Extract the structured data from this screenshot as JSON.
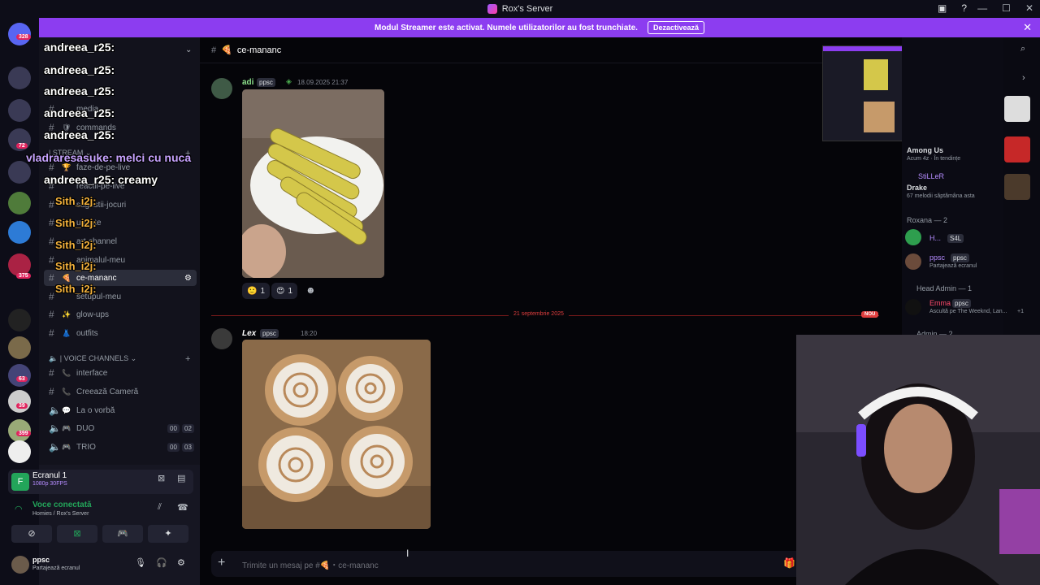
{
  "titlebar": {
    "title": "Rox's Server"
  },
  "banner": {
    "text": "Modul Streamer este activat. Numele utilizatorilor au fost trunchiate.",
    "button": "Dezactivează"
  },
  "guilds": {
    "badges": [
      "328",
      "72",
      "375",
      "63",
      "39",
      "399"
    ]
  },
  "channels": {
    "items": [
      {
        "name": "media",
        "emoji": ""
      },
      {
        "name": "commands",
        "emoji": "🛡"
      },
      {
        "name": "faze-de-pe-live",
        "emoji": "🏆"
      },
      {
        "name": "reactii-pe-live",
        "emoji": ""
      },
      {
        "name": "sugestii-jocuri",
        "emoji": ""
      },
      {
        "name": "update",
        "emoji": ""
      },
      {
        "name": "art-channel",
        "emoji": ""
      },
      {
        "name": "animalul-meu",
        "emoji": ""
      },
      {
        "name": "ce-mananc",
        "emoji": "🍕"
      },
      {
        "name": "setupul-meu",
        "emoji": ""
      },
      {
        "name": "glow-ups",
        "emoji": "✨"
      },
      {
        "name": "outfits",
        "emoji": "👗"
      }
    ],
    "category_stream": "| STREAM",
    "category_voice": "| VOICE CHANNELS",
    "voice": [
      {
        "name": "interface",
        "kind": "text"
      },
      {
        "name": "Creează Cameră",
        "kind": "text"
      },
      {
        "name": "La o vorbă",
        "kind": "voice"
      },
      {
        "name": "DUO",
        "kind": "voice",
        "a": "00",
        "b": "02"
      },
      {
        "name": "TRIO",
        "kind": "voice",
        "a": "00",
        "b": "03"
      }
    ]
  },
  "overlay_chat": [
    {
      "text": "andreea_r25:",
      "style": "white"
    },
    {
      "text": "andreea_r25:",
      "style": "white"
    },
    {
      "text": "andreea_r25:",
      "style": "white"
    },
    {
      "text": "andreea_r25:",
      "style": "white"
    },
    {
      "text": "andreea_r25:",
      "style": "white"
    },
    {
      "text": "vladraresasuke: melci cu nuca",
      "style": "purple"
    },
    {
      "text": "andreea_r25: creamy",
      "style": "white"
    },
    {
      "text": "Sith_i2j:",
      "style": "gold"
    },
    {
      "text": "Sith_i2j:",
      "style": "gold"
    },
    {
      "text": "Sith_i2j:",
      "style": "gold"
    },
    {
      "text": "Sith_i2j:",
      "style": "gold"
    },
    {
      "text": "Sith_i2j:",
      "style": "gold"
    }
  ],
  "userpanel": {
    "screen_title": "Ecranul 1",
    "screen_sub": "1080p 30FPS",
    "voice_title": "Voce conectată",
    "voice_sub": "Homies / Rox's Server",
    "user_name": "ppsc",
    "user_status": "Partajează ecranul"
  },
  "chat": {
    "channel": "ce-mananc",
    "msg1": {
      "author": "adi",
      "tag": "ppsc",
      "time": "18.09.2025 21:37"
    },
    "reactions": [
      {
        "emoji": "🙂",
        "count": "1"
      },
      {
        "emoji": "😍",
        "count": "1"
      }
    ],
    "divider_date": "21 septembrie 2025",
    "nou": "NOU",
    "msg2": {
      "author": "Lex",
      "tag": "ppsc",
      "time": "18:20"
    },
    "input_placeholder": "Trimite un mesaj pe #🍕・ce-mananc"
  },
  "members": {
    "activity1_title": "Among Us",
    "activity1_sub": "Acum 4z · În tendințe",
    "activity2_user": "StiLLeR",
    "activity2_title": "Drake",
    "activity2_sub": "67 melodii săptămâna asta",
    "group1": "Roxana — 2",
    "m1_name": "H...",
    "m1_tag": "S4L",
    "m2_name": "ppsc",
    "m2_tag": "ppsc",
    "m2_status": "Partajează ecranul",
    "group2": "Head Admin — 1",
    "m3_name": "Emma",
    "m3_tag": "ppsc",
    "m3_status": "Ascultă pe The Weeknd, Lan...",
    "m3_extra": "+1",
    "group3": "Admin — 2"
  },
  "colors": {
    "accent": "#8c3df0",
    "new_divider": "#e03e3e",
    "background": "#050509"
  }
}
